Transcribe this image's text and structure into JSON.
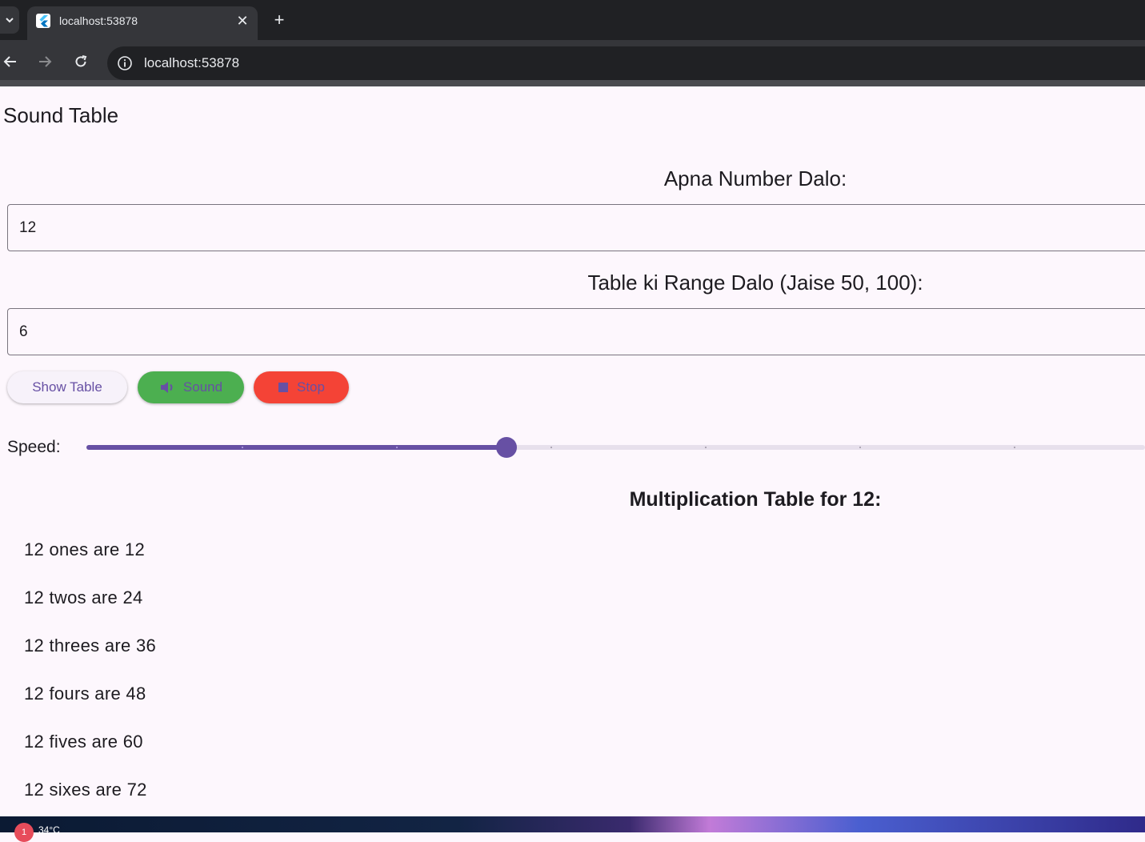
{
  "browser": {
    "tab_title": "localhost:53878",
    "url": "localhost:53878"
  },
  "app": {
    "title": "Sound Table",
    "number_label": "Apna Number Dalo:",
    "number_value": "12",
    "range_label": "Table ki Range Dalo (Jaise 50, 100):",
    "range_value": "6",
    "buttons": {
      "show_table": "Show Table",
      "sound": "Sound",
      "stop": "Stop"
    },
    "speed_label": "Speed:",
    "speed_level": 0.45,
    "speed_divisions": 7,
    "table_title": "Multiplication Table for 12:",
    "table_rows": [
      "12 ones are 12",
      "12 twos are 24",
      "12 threes are 36",
      "12 fours are 48",
      "12 fives are 60",
      "12 sixes are 72"
    ]
  },
  "taskbar": {
    "weather_badge": "1",
    "temperature": "34°C"
  },
  "colors": {
    "primary": "#6750a4",
    "sound_button": "#4caf50",
    "stop_button": "#f44336",
    "background": "#fdf7fd"
  }
}
